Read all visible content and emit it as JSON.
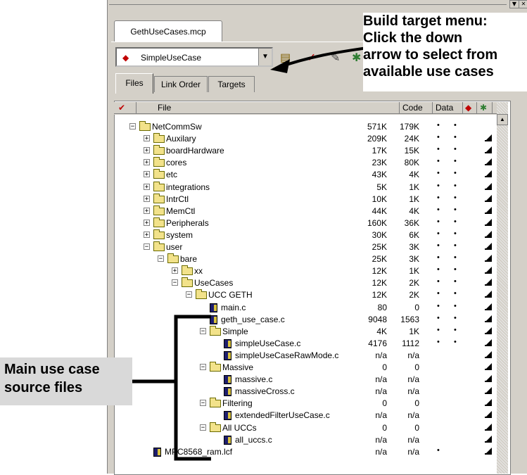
{
  "window": {
    "project_tab": "GethUseCases.mcp",
    "build_target": "SimpleUseCase",
    "subtabs": [
      "Files",
      "Link Order",
      "Targets"
    ]
  },
  "columns": {
    "file": "File",
    "code": "Code",
    "data": "Data"
  },
  "rows": [
    {
      "name": "NetCommSw",
      "kind": "folder",
      "expander": "−",
      "code": "571K",
      "data": "179K",
      "dot1": "•",
      "dot2": "•",
      "chk": false
    },
    {
      "name": "Auxilary",
      "kind": "folder",
      "expander": "+",
      "code": "209K",
      "data": "24K",
      "dot1": "•",
      "dot2": "•",
      "chk": true
    },
    {
      "name": "boardHardware",
      "kind": "folder",
      "expander": "+",
      "code": "17K",
      "data": "15K",
      "dot1": "•",
      "dot2": "•",
      "chk": true
    },
    {
      "name": "cores",
      "kind": "folder",
      "expander": "+",
      "code": "23K",
      "data": "80K",
      "dot1": "•",
      "dot2": "•",
      "chk": true
    },
    {
      "name": "etc",
      "kind": "folder",
      "expander": "+",
      "code": "43K",
      "data": "4K",
      "dot1": "•",
      "dot2": "•",
      "chk": true
    },
    {
      "name": "integrations",
      "kind": "folder",
      "expander": "+",
      "code": "5K",
      "data": "1K",
      "dot1": "•",
      "dot2": "•",
      "chk": true
    },
    {
      "name": "IntrCtl",
      "kind": "folder",
      "expander": "+",
      "code": "10K",
      "data": "1K",
      "dot1": "•",
      "dot2": "•",
      "chk": true
    },
    {
      "name": "MemCtl",
      "kind": "folder",
      "expander": "+",
      "code": "44K",
      "data": "4K",
      "dot1": "•",
      "dot2": "•",
      "chk": true
    },
    {
      "name": "Peripherals",
      "kind": "folder",
      "expander": "+",
      "code": "160K",
      "data": "36K",
      "dot1": "•",
      "dot2": "•",
      "chk": true
    },
    {
      "name": "system",
      "kind": "folder",
      "expander": "+",
      "code": "30K",
      "data": "6K",
      "dot1": "•",
      "dot2": "•",
      "chk": true
    },
    {
      "name": "user",
      "kind": "folder",
      "expander": "−",
      "code": "25K",
      "data": "3K",
      "dot1": "•",
      "dot2": "•",
      "chk": true
    },
    {
      "name": "bare",
      "kind": "folder",
      "expander": "−",
      "code": "25K",
      "data": "3K",
      "dot1": "•",
      "dot2": "•",
      "chk": true
    },
    {
      "name": "xx",
      "kind": "folder",
      "expander": "+",
      "code": "12K",
      "data": "1K",
      "dot1": "•",
      "dot2": "•",
      "chk": true
    },
    {
      "name": "UseCases",
      "kind": "folder",
      "expander": "−",
      "code": "12K",
      "data": "2K",
      "dot1": "•",
      "dot2": "•",
      "chk": true
    },
    {
      "name": "UCC GETH",
      "kind": "folder",
      "expander": "−",
      "code": "12K",
      "data": "2K",
      "dot1": "•",
      "dot2": "•",
      "chk": true
    },
    {
      "name": "main.c",
      "kind": "file",
      "expander": "",
      "code": "80",
      "data": "0",
      "dot1": "•",
      "dot2": "•",
      "chk": true
    },
    {
      "name": "geth_use_case.c",
      "kind": "file",
      "expander": "",
      "code": "9048",
      "data": "1563",
      "dot1": "•",
      "dot2": "•",
      "chk": true
    },
    {
      "name": "Simple",
      "kind": "folder",
      "expander": "−",
      "code": "4K",
      "data": "1K",
      "dot1": "•",
      "dot2": "•",
      "chk": true
    },
    {
      "name": "simpleUseCase.c",
      "kind": "file",
      "expander": "",
      "code": "4176",
      "data": "1112",
      "dot1": "•",
      "dot2": "•",
      "chk": true
    },
    {
      "name": "simpleUseCaseRawMode.c",
      "kind": "file",
      "expander": "",
      "code": "n/a",
      "data": "n/a",
      "dot1": "",
      "dot2": "",
      "chk": true
    },
    {
      "name": "Massive",
      "kind": "folder",
      "expander": "−",
      "code": "0",
      "data": "0",
      "dot1": "",
      "dot2": "",
      "chk": true
    },
    {
      "name": "massive.c",
      "kind": "file",
      "expander": "",
      "code": "n/a",
      "data": "n/a",
      "dot1": "",
      "dot2": "",
      "chk": true
    },
    {
      "name": "massiveCross.c",
      "kind": "file",
      "expander": "",
      "code": "n/a",
      "data": "n/a",
      "dot1": "",
      "dot2": "",
      "chk": true
    },
    {
      "name": "Filtering",
      "kind": "folder",
      "expander": "−",
      "code": "0",
      "data": "0",
      "dot1": "",
      "dot2": "",
      "chk": true
    },
    {
      "name": "extendedFilterUseCase.c",
      "kind": "file",
      "expander": "",
      "code": "n/a",
      "data": "n/a",
      "dot1": "",
      "dot2": "",
      "chk": true
    },
    {
      "name": "All UCCs",
      "kind": "folder",
      "expander": "−",
      "code": "0",
      "data": "0",
      "dot1": "",
      "dot2": "",
      "chk": true
    },
    {
      "name": "all_uccs.c",
      "kind": "file",
      "expander": "",
      "code": "n/a",
      "data": "n/a",
      "dot1": "",
      "dot2": "",
      "chk": true
    },
    {
      "name": "MPC8568_ram.lcf",
      "kind": "file",
      "expander": "",
      "code": "n/a",
      "data": "n/a",
      "dot1": "•",
      "dot2": "",
      "chk": true
    }
  ],
  "annotations": {
    "build_target_callout": [
      "Build target menu:",
      "Click the down",
      "arrow to select from",
      "available use cases"
    ],
    "source_files_callout": [
      "Main use case",
      "source files"
    ]
  },
  "colors": {
    "panel": "#d4d0c8",
    "folder": "#f2e28a",
    "target_icon": "#c00000",
    "debug_icon": "#2e7d32"
  }
}
